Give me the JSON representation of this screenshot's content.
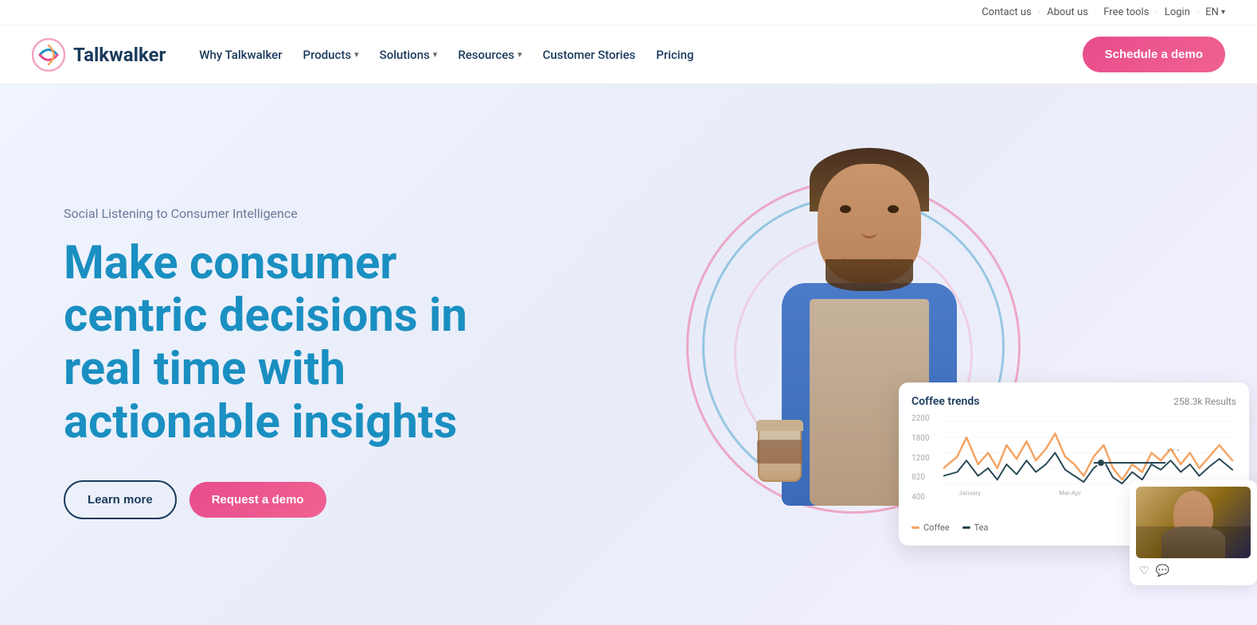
{
  "utility": {
    "contact": "Contact us",
    "about": "About us",
    "free_tools": "Free tools",
    "login": "Login",
    "lang": "EN",
    "sep": "·"
  },
  "nav": {
    "logo_text": "Talkwalker",
    "links": [
      {
        "label": "Why Talkwalker",
        "has_dropdown": false
      },
      {
        "label": "Products",
        "has_dropdown": true
      },
      {
        "label": "Solutions",
        "has_dropdown": true
      },
      {
        "label": "Resources",
        "has_dropdown": true
      },
      {
        "label": "Customer Stories",
        "has_dropdown": false
      },
      {
        "label": "Pricing",
        "has_dropdown": false
      }
    ],
    "cta": "Schedule a demo"
  },
  "hero": {
    "subtitle": "Social Listening to Consumer Intelligence",
    "title_line1": "Make consumer",
    "title_line2": "centric decisions in",
    "title_line3": "real time with",
    "title_line4": "actionable insights",
    "btn_learn": "Learn more",
    "btn_demo": "Request a demo"
  },
  "dashboard": {
    "title": "Coffee trends",
    "results": "258.3k Results",
    "y_labels": [
      "2200",
      "1800",
      "1200",
      "820",
      "400"
    ],
    "legend": [
      {
        "label": "Coffee",
        "color": "#f4a261"
      },
      {
        "label": "Tea",
        "color": "#264653"
      }
    ]
  },
  "colors": {
    "brand_blue": "#1a8fc1",
    "brand_dark": "#1a3a5c",
    "brand_pink": "#e84c8b",
    "accent_orange": "#f4a261"
  }
}
